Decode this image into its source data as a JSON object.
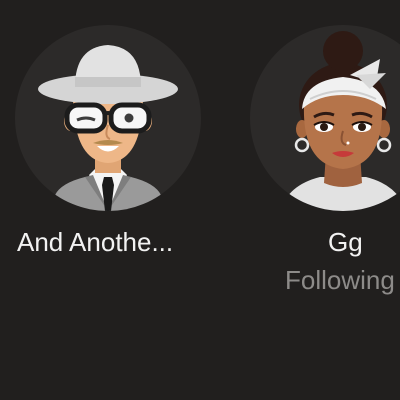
{
  "friends": [
    {
      "name": "And Anothe...",
      "status": "",
      "avatar": "avatar-man-with-hat-and-glasses"
    },
    {
      "name": "Gg",
      "status": "Following",
      "avatar": "avatar-woman-with-headband"
    }
  ],
  "colors": {
    "background": "#211f1e",
    "avatar_bg": "#2c2a29",
    "name_text": "#f2f2f2",
    "status_text": "#8d8b89"
  }
}
